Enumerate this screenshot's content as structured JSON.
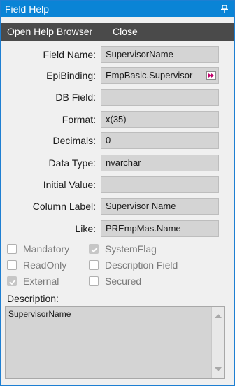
{
  "window": {
    "title": "Field Help",
    "pin_icon": "pin-icon"
  },
  "menu": {
    "open_help_browser": "Open Help Browser",
    "close": "Close"
  },
  "fields": {
    "field_name": {
      "label": "Field Name:",
      "value": "SupervisorName"
    },
    "epi_binding": {
      "label": "EpiBinding:",
      "value": "EmpBasic.Supervisor"
    },
    "db_field": {
      "label": "DB Field:",
      "value": ""
    },
    "format": {
      "label": "Format:",
      "value": "x(35)"
    },
    "decimals": {
      "label": "Decimals:",
      "value": "0"
    },
    "data_type": {
      "label": "Data Type:",
      "value": "nvarchar"
    },
    "initial_value": {
      "label": "Initial Value:",
      "value": ""
    },
    "column_label": {
      "label": "Column Label:",
      "value": "Supervisor Name"
    },
    "like": {
      "label": "Like:",
      "value": "PREmpMas.Name"
    }
  },
  "flags": {
    "mandatory": {
      "label": "Mandatory",
      "checked": false
    },
    "system_flag": {
      "label": "SystemFlag",
      "checked": true
    },
    "read_only": {
      "label": "ReadOnly",
      "checked": false
    },
    "description_field": {
      "label": "Description Field",
      "checked": false
    },
    "external": {
      "label": "External",
      "checked": true
    },
    "secured": {
      "label": "Secured",
      "checked": false
    }
  },
  "description": {
    "label": "Description:",
    "value": "SupervisorName"
  },
  "colors": {
    "titlebar": "#0a84d6",
    "menubar": "#4a4a4a",
    "field_bg": "#d4d4d4",
    "window_bg": "#f0f0f0"
  }
}
